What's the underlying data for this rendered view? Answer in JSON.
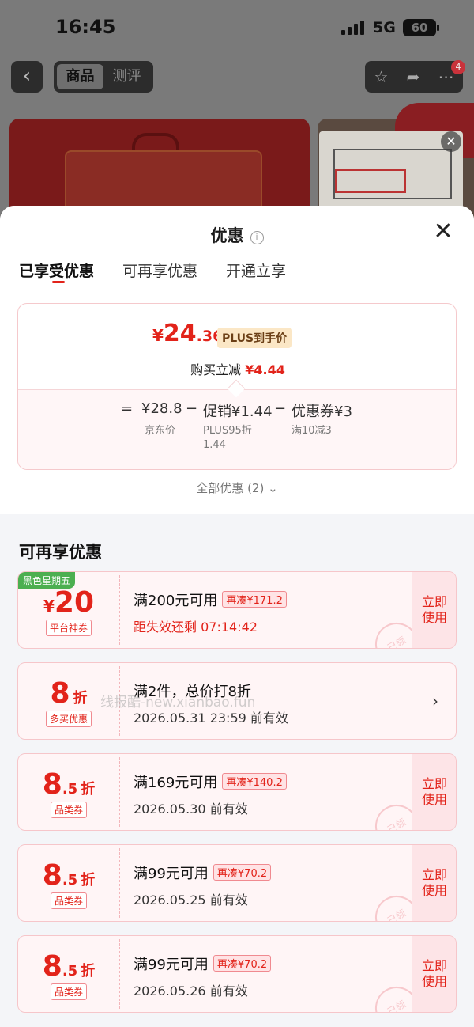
{
  "status_bar": {
    "time": "16:45",
    "network": "5G",
    "battery": "60"
  },
  "nav": {
    "tabs": [
      "商品",
      "测评"
    ],
    "active_tab": 0,
    "badge_count": "4"
  },
  "sheet": {
    "title": "优惠",
    "tabs": [
      "已享受优惠",
      "可再享优惠",
      "开通立享"
    ],
    "active_tab": 0,
    "summary": {
      "currency": "¥",
      "price_int": "24",
      "price_dec": ".36",
      "price_tag": "PLUS到手价",
      "cut_label": "购买立减",
      "cut_amount": "¥4.44",
      "eq": "=",
      "base_price": "¥28.8",
      "minus1": "−",
      "promo": "促销¥1.44",
      "minus2": "−",
      "coupon": "优惠券¥3",
      "base_label": "京东价",
      "promo_label_1": "PLUS95折",
      "promo_label_2": "1.44",
      "coupon_label": "满10减3"
    },
    "all_discounts": "全部优惠 (2)",
    "section_title": "可再享优惠",
    "coupons": [
      {
        "tag": "黑色星期五",
        "yen": "¥",
        "num": "20",
        "dec": "",
        "zhe": "",
        "label": "平台神券",
        "title": "满200元可用",
        "extra": "再凑¥171.2",
        "sub": "距失效还剩 07:14:42",
        "sub_red": true,
        "action_1": "立即",
        "action_2": "使用",
        "stamp": "已领"
      },
      {
        "tag": "",
        "yen": "",
        "num": "8",
        "dec": "",
        "zhe": "折",
        "label": "多买优惠",
        "title": "满2件，总价打8折",
        "extra": "",
        "sub": "2026.05.31 23:59 前有效",
        "sub_red": false,
        "action_1": "",
        "action_2": "",
        "stamp": ""
      },
      {
        "tag": "",
        "yen": "",
        "num": "8",
        "dec": ".5",
        "zhe": "折",
        "label": "品类券",
        "title": "满169元可用",
        "extra": "再凑¥140.2",
        "sub": "2026.05.30 前有效",
        "sub_red": false,
        "action_1": "立即",
        "action_2": "使用",
        "stamp": "已领"
      },
      {
        "tag": "",
        "yen": "",
        "num": "8",
        "dec": ".5",
        "zhe": "折",
        "label": "品类券",
        "title": "满99元可用",
        "extra": "再凑¥70.2",
        "sub": "2026.05.25 前有效",
        "sub_red": false,
        "action_1": "立即",
        "action_2": "使用",
        "stamp": "已领"
      },
      {
        "tag": "",
        "yen": "",
        "num": "8",
        "dec": ".5",
        "zhe": "折",
        "label": "品类券",
        "title": "满99元可用",
        "extra": "再凑¥70.2",
        "sub": "2026.05.26 前有效",
        "sub_red": false,
        "action_1": "立即",
        "action_2": "使用",
        "stamp": "已领"
      }
    ],
    "watermark": "线报酷-new.xianbao.fun"
  },
  "colors": {
    "accent": "#e2231a",
    "plus_tag_bg": "#fbe7c6",
    "card_border": "#f6c6ca",
    "green_tag": "#4caf50"
  }
}
